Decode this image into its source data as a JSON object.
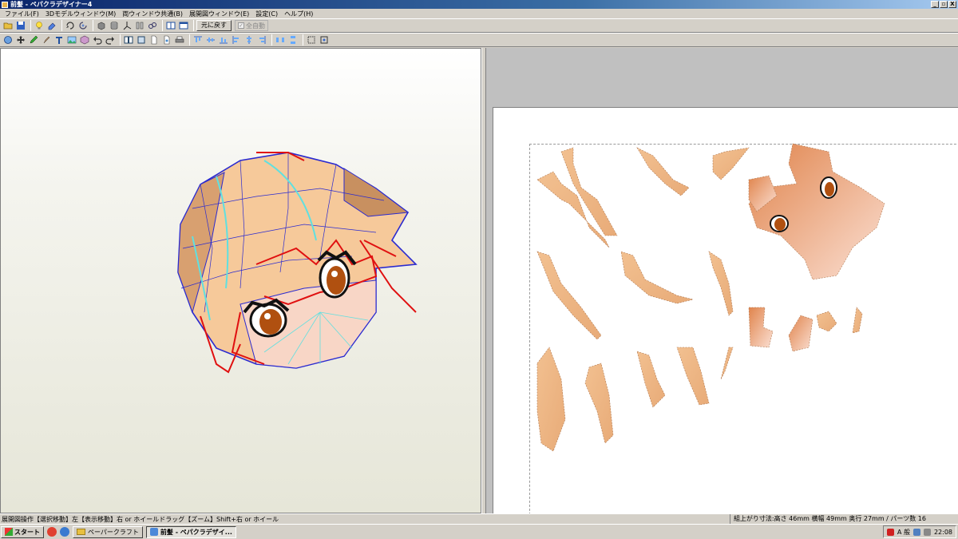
{
  "window": {
    "title": "前髪 - ペパクラデザイナー4",
    "minimize": "_",
    "restore": "▫",
    "close": "X"
  },
  "menu": [
    "ファイル(F)",
    "3Dモデルウィンドウ(M)",
    "両ウィンドウ共通(B)",
    "展開図ウィンドウ(E)",
    "設定(C)",
    "ヘルプ(H)"
  ],
  "toolbar": {
    "undo_label": "元に戻す",
    "auto_label": "全自動"
  },
  "status": {
    "left": "展開図操作【選択移動】左【表示移動】右 or ホイールドラッグ【ズーム】Shift+右 or ホイール",
    "right": "組上がり寸法:高さ 46mm 横幅 49mm 奥行 27mm / パーツ数 16"
  },
  "taskbar": {
    "start": "スタート",
    "tasks": [
      "ペーパークラフト",
      "前髪 - ペパクラデザイ..."
    ],
    "tray_text": "A 般",
    "clock": "22:08"
  },
  "colors": {
    "skin": "#f6c99a",
    "skin_dark": "#d89a6a",
    "outline_blue": "#2a2ad0",
    "outline_red": "#e01010",
    "outline_cyan": "#60e0e0",
    "eye": "#b05010"
  }
}
